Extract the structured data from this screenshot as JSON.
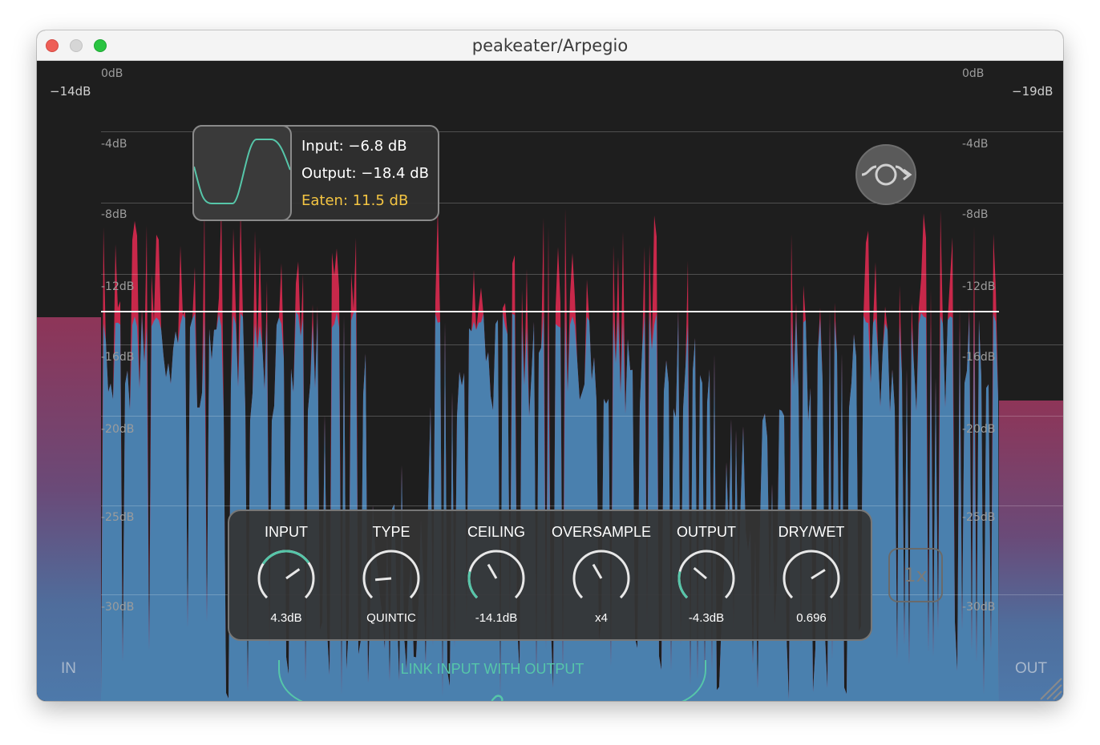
{
  "window": {
    "title": "peakeater/Arpegio"
  },
  "meters": {
    "in": {
      "label": "IN",
      "peak": "−14dB",
      "level": 0.49
    },
    "out": {
      "label": "OUT",
      "peak": "−19dB",
      "level": 0.38
    }
  },
  "scale": {
    "left": [
      "0dB",
      "-4dB",
      "-8dB",
      "-12dB",
      "-16dB",
      "-20dB",
      "-25dB",
      "-30dB"
    ],
    "right": [
      "0dB",
      "-4dB",
      "-8dB",
      "-12dB",
      "-16dB",
      "-20dB",
      "-25dB",
      "-30dB"
    ]
  },
  "info": {
    "input": "Input: −6.8 dB",
    "output": "Output: −18.4 dB",
    "eaten": "Eaten: 11.5 dB"
  },
  "controls": [
    {
      "title": "INPUT",
      "value": "4.3dB"
    },
    {
      "title": "TYPE",
      "value": "QUINTIC"
    },
    {
      "title": "CEILING",
      "value": "-14.1dB"
    },
    {
      "title": "OVERSAMPLE",
      "value": "x4"
    },
    {
      "title": "OUTPUT",
      "value": "-4.3dB"
    },
    {
      "title": "DRY/WET",
      "value": "0.696"
    }
  ],
  "oversample_button": {
    "label": "1x"
  },
  "link": {
    "label": "LINK INPUT WITH OUTPUT"
  },
  "icons": {
    "bypass": "bypass-loop-icon",
    "link": "chain-link-icon",
    "resize": "resize-grip-icon",
    "curve": "waveshaper-curve-icon"
  },
  "colors": {
    "accent": "#56c6a9",
    "eaten": "#f4c542",
    "clipped": "#c8284a",
    "signal": "#4a80ae",
    "background": "#1e1e1e"
  }
}
